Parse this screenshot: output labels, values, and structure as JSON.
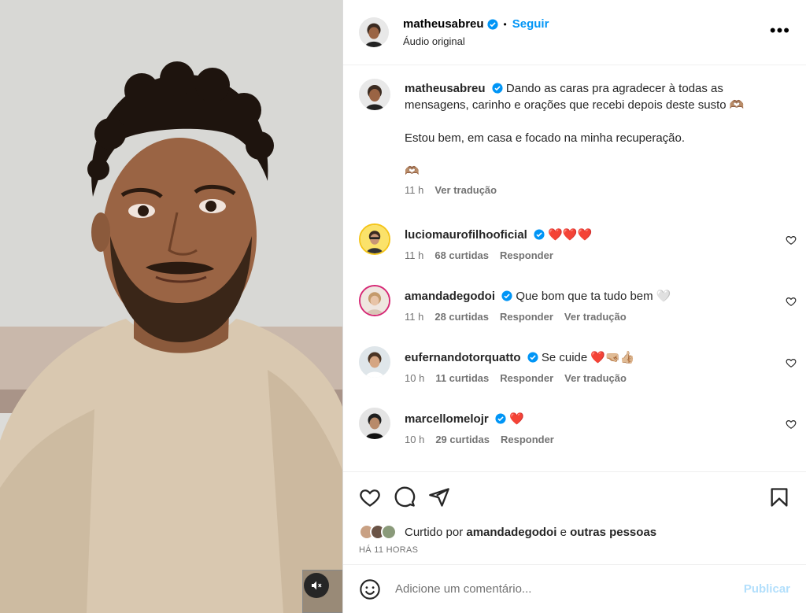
{
  "post": {
    "username": "matheusabreu",
    "follow_label": "Seguir",
    "audio": "Áudio original",
    "more_label": "•••"
  },
  "caption": {
    "username": "matheusabreu",
    "line1": "Dando as caras pra agradecer à todas as mensagens, carinho e orações que recebi depois deste susto 🫶🏽",
    "line2": "Estou bem, em casa e focado na minha recuperação.",
    "line3": "🫶🏽",
    "time": "11 h",
    "translate": "Ver tradução"
  },
  "comments": [
    {
      "username": "luciomaurofilhooficial",
      "text": "❤️❤️❤️",
      "time": "11 h",
      "likes": "68 curtidas",
      "reply": "Responder",
      "translate": ""
    },
    {
      "username": "amandadegodoi",
      "text": "Que bom que ta tudo bem 🤍",
      "time": "11 h",
      "likes": "28 curtidas",
      "reply": "Responder",
      "translate": "Ver tradução"
    },
    {
      "username": "eufernandotorquatto",
      "text": "Se cuide ❤️🤜🏼👍🏼",
      "time": "10 h",
      "likes": "11 curtidas",
      "reply": "Responder",
      "translate": "Ver tradução"
    },
    {
      "username": "marcellomelojr",
      "text": "❤️",
      "time": "10 h",
      "likes": "29 curtidas",
      "reply": "Responder",
      "translate": ""
    }
  ],
  "likes": {
    "prefix": "Curtido por",
    "user": "amandadegodoi",
    "and": "e",
    "others": "outras pessoas"
  },
  "date": "HÁ 11 HORAS",
  "add_comment": {
    "placeholder": "Adicione um comentário...",
    "publish": "Publicar"
  },
  "colors": {
    "accent": "#0095f6",
    "publish_disabled": "#b2dffc",
    "verified": "#0095f6"
  }
}
